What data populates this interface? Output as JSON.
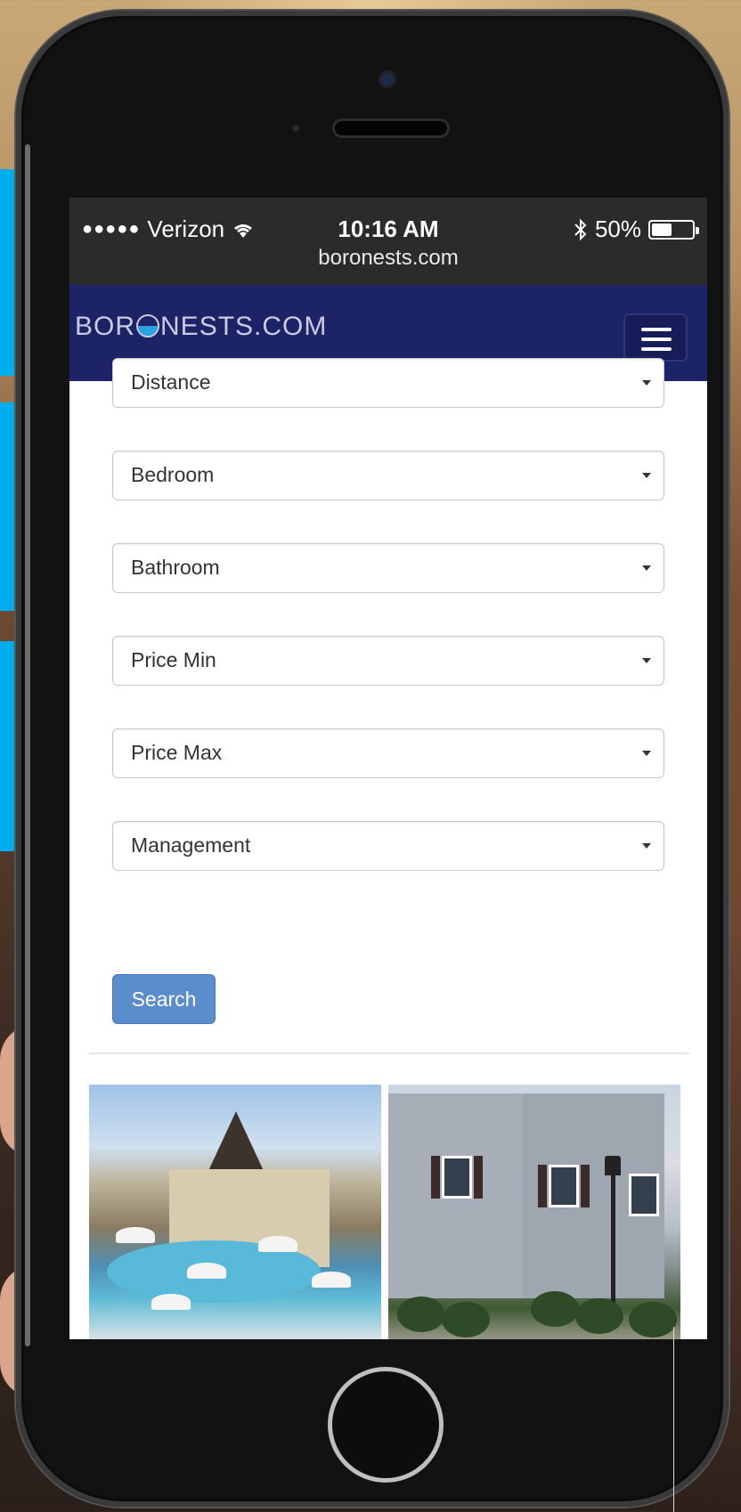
{
  "status_bar": {
    "signal_dots": "●●●●●",
    "carrier": "Verizon",
    "time": "10:16 AM",
    "battery_percent": "50%",
    "battery_level": 0.5,
    "url": "boronests.com"
  },
  "navbar": {
    "logo_prefix": "BOR",
    "logo_suffix": "NESTS.COM",
    "menu_icon": "hamburger-menu-icon"
  },
  "filters": [
    {
      "placeholder": "Distance"
    },
    {
      "placeholder": "Bedroom"
    },
    {
      "placeholder": "Bathroom"
    },
    {
      "placeholder": "Price Min"
    },
    {
      "placeholder": "Price Max"
    },
    {
      "placeholder": "Management"
    }
  ],
  "search_button": "Search",
  "colors": {
    "navbar": "#1c2366",
    "search_button": "#5b8ccb",
    "accent_tab": "#00aeef"
  }
}
